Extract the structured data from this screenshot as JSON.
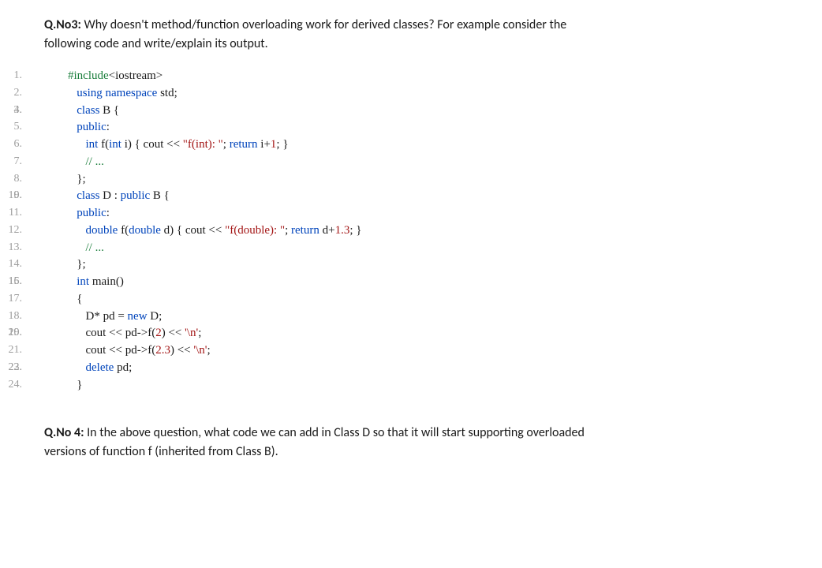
{
  "q3": {
    "label": "Q.No3:",
    "text_line1": " Why doesn't method/function overloading work for derived classes? For example consider the",
    "text_line2": "following code and write/explain its output."
  },
  "code": {
    "lines": [
      {
        "no": "1.",
        "indent": "",
        "tokens": [
          {
            "c": "kw-preproc",
            "t": "#include"
          },
          {
            "c": "plain",
            "t": "<"
          },
          {
            "c": "plain",
            "t": "iostream"
          },
          {
            "c": "plain",
            "t": ">"
          }
        ]
      },
      {
        "no": "2.",
        "indent": "   ",
        "tokens": [
          {
            "c": "kw-blue",
            "t": "using"
          },
          {
            "c": "plain",
            "t": " "
          },
          {
            "c": "kw-blue",
            "t": "namespace"
          },
          {
            "c": "plain",
            "t": " std;"
          }
        ]
      },
      {
        "no": "3.",
        "indent": "",
        "tokens": [
          {
            "c": "plain",
            "t": ""
          }
        ]
      },
      {
        "no": "4.",
        "indent": "   ",
        "tokens": [
          {
            "c": "kw-blue",
            "t": "class"
          },
          {
            "c": "plain",
            "t": " B {"
          }
        ]
      },
      {
        "no": "5.",
        "indent": "   ",
        "tokens": [
          {
            "c": "kw-blue",
            "t": "public"
          },
          {
            "c": "plain",
            "t": ":"
          }
        ]
      },
      {
        "no": "6.",
        "indent": "      ",
        "tokens": [
          {
            "c": "kw-blue",
            "t": "int"
          },
          {
            "c": "plain",
            "t": " f("
          },
          {
            "c": "kw-blue",
            "t": "int"
          },
          {
            "c": "plain",
            "t": " i) { cout << "
          },
          {
            "c": "kw-str",
            "t": "\"f(int): \""
          },
          {
            "c": "plain",
            "t": "; "
          },
          {
            "c": "kw-blue",
            "t": "return"
          },
          {
            "c": "plain",
            "t": " i+"
          },
          {
            "c": "kw-num",
            "t": "1"
          },
          {
            "c": "plain",
            "t": "; }"
          }
        ]
      },
      {
        "no": "7.",
        "indent": "      ",
        "tokens": [
          {
            "c": "kw-comment",
            "t": "// ..."
          }
        ]
      },
      {
        "no": "8.",
        "indent": "   ",
        "tokens": [
          {
            "c": "plain",
            "t": "};"
          }
        ]
      },
      {
        "no": "9.",
        "indent": "",
        "tokens": [
          {
            "c": "plain",
            "t": ""
          }
        ]
      },
      {
        "no": "10.",
        "indent": "   ",
        "tokens": [
          {
            "c": "kw-blue",
            "t": "class"
          },
          {
            "c": "plain",
            "t": " D : "
          },
          {
            "c": "kw-blue",
            "t": "public"
          },
          {
            "c": "plain",
            "t": " B {"
          }
        ]
      },
      {
        "no": "11.",
        "indent": "   ",
        "tokens": [
          {
            "c": "kw-blue",
            "t": "public"
          },
          {
            "c": "plain",
            "t": ":"
          }
        ]
      },
      {
        "no": "12.",
        "indent": "      ",
        "tokens": [
          {
            "c": "kw-blue",
            "t": "double"
          },
          {
            "c": "plain",
            "t": " f("
          },
          {
            "c": "kw-blue",
            "t": "double"
          },
          {
            "c": "plain",
            "t": " d) { cout << "
          },
          {
            "c": "kw-str",
            "t": "\"f(double): \""
          },
          {
            "c": "plain",
            "t": "; "
          },
          {
            "c": "kw-blue",
            "t": "return"
          },
          {
            "c": "plain",
            "t": " d+"
          },
          {
            "c": "kw-num",
            "t": "1.3"
          },
          {
            "c": "plain",
            "t": "; }"
          }
        ]
      },
      {
        "no": "13.",
        "indent": "      ",
        "tokens": [
          {
            "c": "kw-comment",
            "t": "// ..."
          }
        ]
      },
      {
        "no": "14.",
        "indent": "   ",
        "tokens": [
          {
            "c": "plain",
            "t": "};"
          }
        ]
      },
      {
        "no": "15.",
        "indent": "",
        "tokens": [
          {
            "c": "plain",
            "t": ""
          }
        ]
      },
      {
        "no": "16.",
        "indent": "   ",
        "tokens": [
          {
            "c": "kw-blue",
            "t": "int"
          },
          {
            "c": "plain",
            "t": " main()"
          }
        ]
      },
      {
        "no": "17.",
        "indent": "   ",
        "tokens": [
          {
            "c": "plain",
            "t": "{"
          }
        ]
      },
      {
        "no": "18.",
        "indent": "      ",
        "tokens": [
          {
            "c": "plain",
            "t": "D* pd = "
          },
          {
            "c": "kw-blue",
            "t": "new"
          },
          {
            "c": "plain",
            "t": " D;"
          }
        ]
      },
      {
        "no": "19.",
        "indent": "",
        "tokens": [
          {
            "c": "plain",
            "t": ""
          }
        ]
      },
      {
        "no": "20.",
        "indent": "      ",
        "tokens": [
          {
            "c": "plain",
            "t": "cout << pd->f("
          },
          {
            "c": "kw-num",
            "t": "2"
          },
          {
            "c": "plain",
            "t": ") << "
          },
          {
            "c": "kw-str",
            "t": "'\\n'"
          },
          {
            "c": "plain",
            "t": ";"
          }
        ]
      },
      {
        "no": "21.",
        "indent": "      ",
        "tokens": [
          {
            "c": "plain",
            "t": "cout << pd->f("
          },
          {
            "c": "kw-num",
            "t": "2.3"
          },
          {
            "c": "plain",
            "t": ") << "
          },
          {
            "c": "kw-str",
            "t": "'\\n'"
          },
          {
            "c": "plain",
            "t": ";"
          }
        ]
      },
      {
        "no": "22.",
        "indent": "",
        "tokens": [
          {
            "c": "plain",
            "t": ""
          }
        ]
      },
      {
        "no": "23.",
        "indent": "      ",
        "tokens": [
          {
            "c": "kw-blue",
            "t": "delete"
          },
          {
            "c": "plain",
            "t": " pd;"
          }
        ]
      },
      {
        "no": "24.",
        "indent": "   ",
        "tokens": [
          {
            "c": "plain",
            "t": "}"
          }
        ]
      }
    ]
  },
  "q4": {
    "label": "Q.No 4:",
    "text_line1": " In the above question, what code we can add in Class D so that it will start supporting overloaded",
    "text_line2": "versions of function f (inherited from Class B)."
  }
}
